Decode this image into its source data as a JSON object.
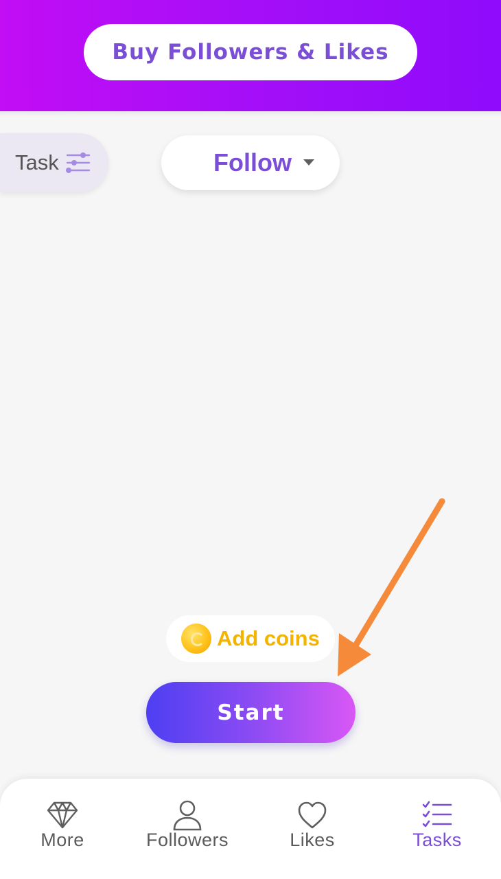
{
  "header": {
    "buy_label": "Buy Followers & Likes"
  },
  "filter": {
    "task_label": "Task"
  },
  "dropdown": {
    "selected": "Follow"
  },
  "coins": {
    "add_label": "Add coins"
  },
  "start": {
    "label": "Start"
  },
  "nav": {
    "items": [
      {
        "label": "More",
        "icon": "diamond-icon"
      },
      {
        "label": "Followers",
        "icon": "person-icon"
      },
      {
        "label": "Likes",
        "icon": "heart-icon"
      },
      {
        "label": "Tasks",
        "icon": "checklist-icon",
        "active": true
      }
    ]
  },
  "colors": {
    "header_gradient_start": "#c20df5",
    "header_gradient_end": "#8f0bfb",
    "accent_purple": "#7a4fd6",
    "coin_yellow": "#f2b400",
    "start_gradient_start": "#4d3ff2",
    "start_gradient_end": "#d957f5",
    "annotation_orange": "#f58a3a"
  }
}
